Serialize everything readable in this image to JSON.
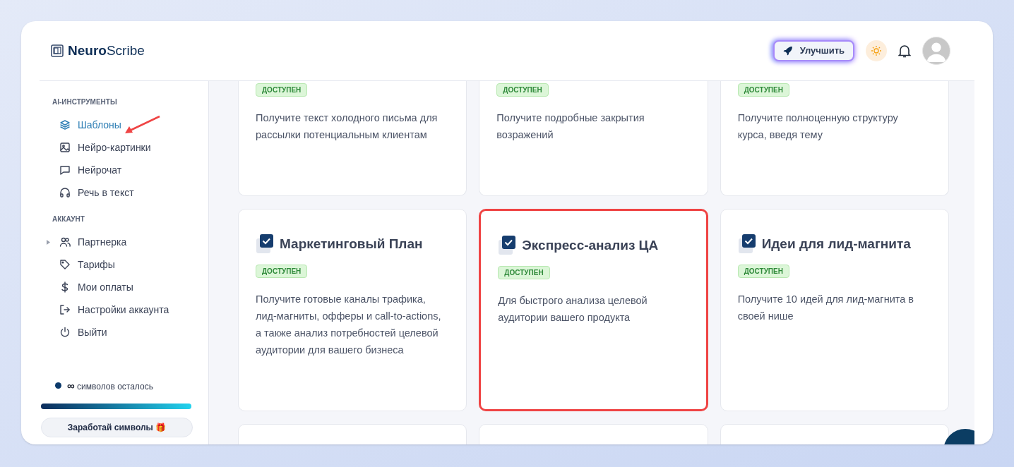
{
  "logo": {
    "bold": "Neuro",
    "light": "Scribe"
  },
  "header": {
    "upgrade_button": "Улучшить"
  },
  "sidebar": {
    "sections": [
      {
        "title": "AI-ИНСТРУМЕНТЫ",
        "items": [
          {
            "label": "Шаблоны",
            "selected": true,
            "expandable": false,
            "annotated": true
          },
          {
            "label": "Нейро-картинки",
            "selected": false,
            "expandable": false,
            "annotated": false
          },
          {
            "label": "Нейрочат",
            "selected": false,
            "expandable": false,
            "annotated": false
          },
          {
            "label": "Речь в текст",
            "selected": false,
            "expandable": false,
            "annotated": false
          }
        ]
      },
      {
        "title": "АККАУНТ",
        "items": [
          {
            "label": "Партнерка",
            "selected": false,
            "expandable": true,
            "annotated": false
          },
          {
            "label": "Тарифы",
            "selected": false,
            "expandable": false,
            "annotated": false
          },
          {
            "label": "Мои оплаты",
            "selected": false,
            "expandable": false,
            "annotated": false
          },
          {
            "label": "Настройки аккаунта",
            "selected": false,
            "expandable": false,
            "annotated": false
          },
          {
            "label": "Выйти",
            "selected": false,
            "expandable": false,
            "annotated": false
          }
        ]
      }
    ],
    "usage": {
      "symbol": "∞",
      "label": "символов осталось",
      "level": 1
    },
    "earn_button": "Заработай символы 🎁"
  },
  "cards": [
    {
      "badge": "ДОСТУПЕН",
      "description": "Получите текст холодного письма для рассылки потенциальным клиентам",
      "highlighted": false
    },
    {
      "badge": "ДОСТУПЕН",
      "description": "Получите подробные закрытия возражений",
      "highlighted": false
    },
    {
      "badge": "ДОСТУПЕН",
      "description": "Получите полноценную структуру курса, введя тему",
      "highlighted": false
    },
    {
      "title": "Маркетинговый План",
      "badge": "ДОСТУПЕН",
      "description": "Получите готовые каналы трафика, лид-магниты, офферы и call-to-actions, а также анализ потребностей целевой аудитории для вашего бизнеса",
      "highlighted": false
    },
    {
      "title": "Экспресс-анализ ЦА",
      "badge": "ДОСТУПЕН",
      "description": "Для быстрого анализа целевой аудитории вашего продукта",
      "highlighted": true
    },
    {
      "title": "Идеи для лид-магнита",
      "badge": "ДОСТУПЕН",
      "description": "Получите 10 идей для лид-магнита в своей нише",
      "highlighted": false
    }
  ]
}
